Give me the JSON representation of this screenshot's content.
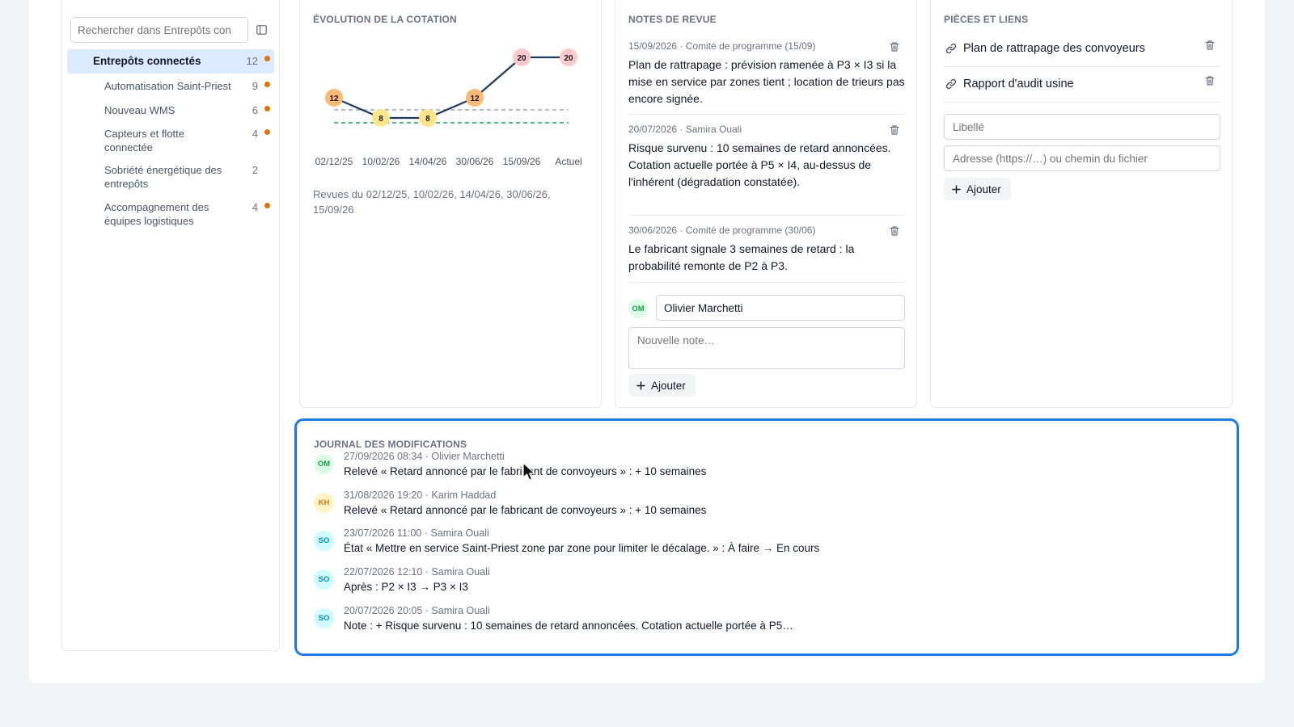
{
  "sidebar": {
    "search_placeholder": "Rechercher dans Entrepôts con",
    "items": [
      {
        "label": "Entrepôts connectés",
        "count": "12",
        "dot": true
      },
      {
        "label": "Automatisation Saint-Priest",
        "count": "9",
        "dot": true
      },
      {
        "label": "Nouveau WMS",
        "count": "6",
        "dot": true
      },
      {
        "label": "Capteurs et flotte connectée",
        "count": "4",
        "dot": true
      },
      {
        "label": "Sobriété énergétique des entrepôts",
        "count": "2",
        "dot": false
      },
      {
        "label": "Accompagnement des équipes logistiques",
        "count": "4",
        "dot": true
      }
    ]
  },
  "cotation": {
    "title": "ÉVOLUTION DE LA COTATION",
    "caption": "Revues du 02/12/25, 10/02/26, 14/04/26, 30/06/26, 15/09/26"
  },
  "chart_data": {
    "type": "line",
    "categories": [
      "02/12/25",
      "10/02/26",
      "14/04/26",
      "30/06/26",
      "15/09/26",
      "Actuel"
    ],
    "values": [
      12,
      8,
      8,
      12,
      20,
      20
    ],
    "reference_lines": [
      {
        "value": 8,
        "style": "dashed",
        "color": "#9ca3af"
      },
      {
        "value": 5,
        "style": "dashed",
        "color": "#16a34a"
      }
    ],
    "ylim": [
      0,
      25
    ],
    "colors": {
      "line": "#1e3a5f",
      "high": "#fecaca",
      "medium": "#fdba74",
      "low": "#fde68a"
    }
  },
  "notes": {
    "title": "NOTES DE REVUE",
    "items": [
      {
        "meta": "15/09/2026 · Comité de programme (15/09)",
        "text": "Plan de rattrapage : prévision ramenée à P3 × I3 si la mise en service par zones tient ; location de trieurs pas encore signée."
      },
      {
        "meta": "20/07/2026 · Samira Ouali",
        "text": "Risque survenu : 10 semaines de retard annoncées. Cotation actuelle portée à P5 × I4, au-dessus de l'inhérent (dégradation constatée)."
      },
      {
        "meta": "30/06/2026 · Comité de programme (30/06)",
        "text": "Le fabricant signale 3 semaines de retard : la probabilité remonte de P2 à P3."
      }
    ],
    "author_initials": "OM",
    "author_value": "Olivier Marchetti",
    "new_note_placeholder": "Nouvelle note…",
    "add_label": "Ajouter"
  },
  "links": {
    "title": "PIÈCES ET LIENS",
    "items": [
      {
        "label": "Plan de rattrapage des convoyeurs"
      },
      {
        "label": "Rapport d'audit usine"
      }
    ],
    "label_placeholder": "Libellé",
    "address_placeholder": "Adresse (https://…) ou chemin du fichier",
    "add_label": "Ajouter"
  },
  "journal": {
    "title": "JOURNAL DES MODIFICATIONS",
    "entries": [
      {
        "initials": "OM",
        "meta": "27/09/2026 08:34 · Olivier Marchetti",
        "msg": "Relevé « Retard annoncé par le fabricant de convoyeurs » : + 10 semaines",
        "bg": "#dcfce7",
        "fg": "#16a34a"
      },
      {
        "initials": "KH",
        "meta": "31/08/2026 19:20 · Karim Haddad",
        "msg": "Relevé « Retard annoncé par le fabricant de convoyeurs » : + 10 semaines",
        "bg": "#fef3c7",
        "fg": "#d97706"
      },
      {
        "initials": "SO",
        "meta": "23/07/2026 11:00 · Samira Ouali",
        "msg": "État « Mettre en service Saint-Priest zone par zone pour limiter le décalage. » : À faire → En cours",
        "bg": "#cffafe",
        "fg": "#0891b2"
      },
      {
        "initials": "SO",
        "meta": "22/07/2026 12:10 · Samira Ouali",
        "msg": "Après : P2 × I3 → P3 × I3",
        "bg": "#cffafe",
        "fg": "#0891b2"
      },
      {
        "initials": "SO",
        "meta": "20/07/2026 20:05 · Samira Ouali",
        "msg": "Note : + Risque survenu : 10 semaines de retard annoncées. Cotation actuelle portée à P5…",
        "bg": "#cffafe",
        "fg": "#0891b2"
      }
    ]
  }
}
